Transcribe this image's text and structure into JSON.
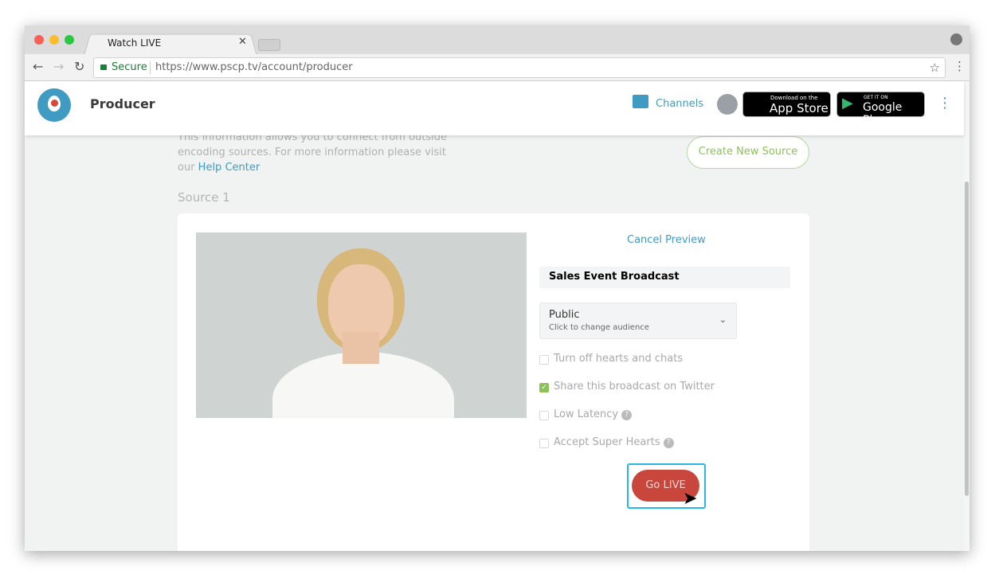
{
  "browser": {
    "tab_title": "Watch LIVE",
    "secure_label": "Secure",
    "url": "https://www.pscp.tv/account/producer"
  },
  "header": {
    "title": "Producer",
    "channels": "Channels",
    "appstore_small": "Download on the",
    "appstore_big": "App Store",
    "google_small": "GET IT ON",
    "google_big": "Google Play"
  },
  "intro": {
    "line1": "This information allows you to connect from outside",
    "line2": "encoding sources. For more information please visit",
    "line3_prefix": "our ",
    "help_link": "Help Center"
  },
  "create_source": "Create New Source",
  "source_title": "Source 1",
  "form": {
    "cancel_preview": "Cancel Preview",
    "title_value": "Sales Event Broadcast",
    "audience": "Public",
    "audience_hint": "Click to change audience",
    "options": [
      {
        "label": "Turn off hearts and chats",
        "checked": false,
        "help": false
      },
      {
        "label": "Share this broadcast on Twitter",
        "checked": true,
        "help": false
      },
      {
        "label": "Low Latency",
        "checked": false,
        "help": true
      },
      {
        "label": "Accept Super Hearts",
        "checked": false,
        "help": true
      }
    ],
    "go_live": "Go LIVE"
  },
  "colors": {
    "accent": "#3f9bc1",
    "live": "#c9463d",
    "green": "#8cc25a"
  }
}
